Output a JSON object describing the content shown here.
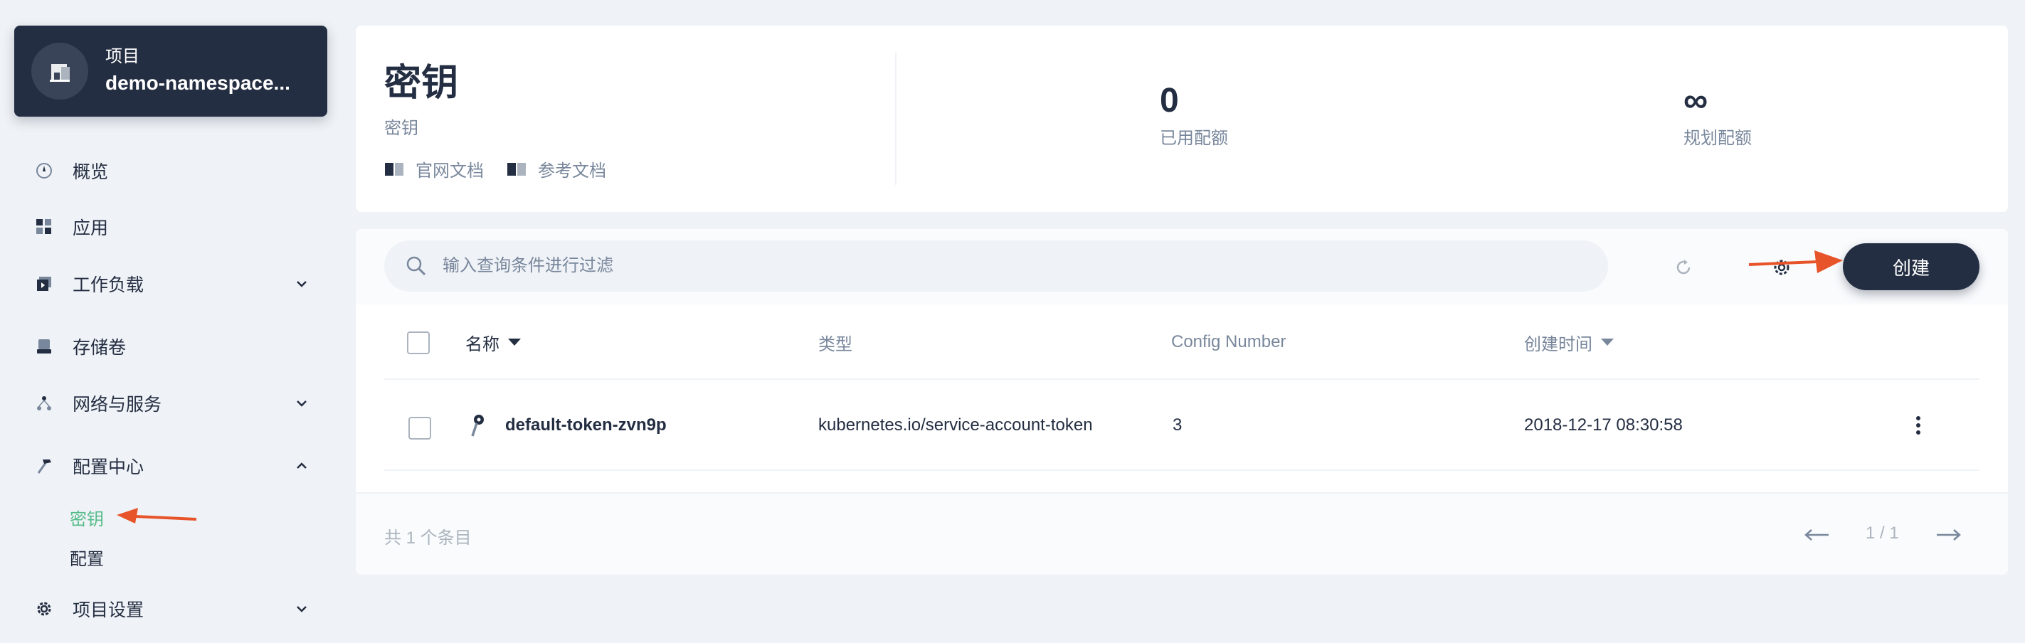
{
  "sidebar": {
    "project": {
      "label": "项目",
      "name": "demo-namespace..."
    },
    "nav": {
      "overview": "概览",
      "apps": "应用",
      "workloads": "工作负载",
      "volumes": "存储卷",
      "network": "网络与服务",
      "config_center": "配置中心",
      "secrets": "密钥",
      "configmaps": "配置",
      "settings": "项目设置"
    },
    "active_color": "#55bc8a"
  },
  "header": {
    "title": "密钥",
    "subtitle": "密钥",
    "doc_links": [
      "官网文档",
      "参考文档"
    ],
    "stats": [
      {
        "value": "0",
        "label": "已用配额"
      },
      {
        "value": "∞",
        "label": "规划配额"
      }
    ]
  },
  "toolbar": {
    "search_placeholder": "输入查询条件进行过滤",
    "create_label": "创建"
  },
  "table": {
    "columns": [
      "名称",
      "类型",
      "Config Number",
      "创建时间"
    ],
    "rows": [
      {
        "name": "default-token-zvn9p",
        "type": "kubernetes.io/service-account-token",
        "config_number": "3",
        "created": "2018-12-17 08:30:58"
      }
    ]
  },
  "footer": {
    "total": "共 1 个条目",
    "page": "1 / 1"
  },
  "colors": {
    "primary": "#242e42",
    "accent_green": "#55bc8a",
    "annotation_arrow": "#e8542a",
    "background": "#eff2f6"
  }
}
